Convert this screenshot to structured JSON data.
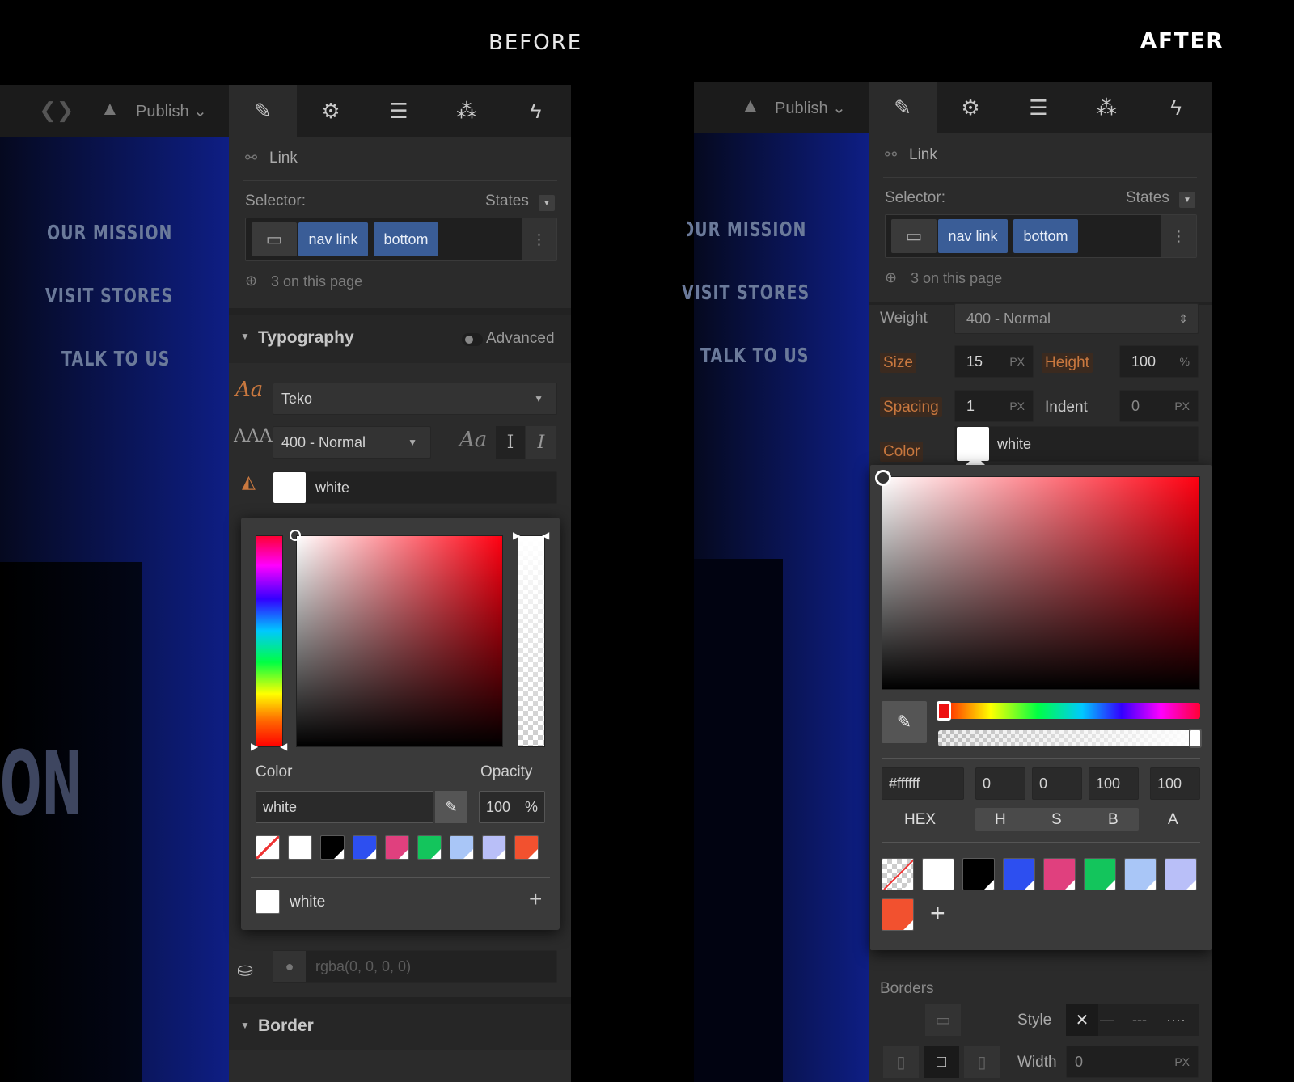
{
  "labels": {
    "before": "BEFORE",
    "after": "AFTER"
  },
  "toolbar": {
    "publish": "Publish"
  },
  "canvas_nav": [
    "OUR MISSION",
    "VISIT STORES",
    "TALK TO US"
  ],
  "panel": {
    "element_type": "Link",
    "selector_label": "Selector:",
    "states_label": "States",
    "tags": [
      "nav link",
      "bottom"
    ],
    "on_page": "3 on this page"
  },
  "before": {
    "typography_title": "Typography",
    "advanced_label": "Advanced",
    "font_family": "Teko",
    "font_weight": "400 - Normal",
    "color_value": "white",
    "picker": {
      "color_label": "Color",
      "opacity_label": "Opacity",
      "color_input": "white",
      "opacity_value": "100",
      "opacity_unit": "%",
      "saved_color_name": "white"
    },
    "background_placeholder": "rgba(0, 0, 0, 0)",
    "border_title": "Border"
  },
  "after": {
    "weight_label": "Weight",
    "weight_value": "400 - Normal",
    "size_label": "Size",
    "size_value": "15",
    "size_unit": "PX",
    "height_label": "Height",
    "height_value": "100",
    "height_unit": "%",
    "spacing_label": "Spacing",
    "spacing_value": "1",
    "spacing_unit": "PX",
    "indent_label": "Indent",
    "indent_value": "0",
    "indent_unit": "PX",
    "color_label": "Color",
    "color_value": "white",
    "picker": {
      "hex_value": "#ffffff",
      "h_value": "0",
      "s_value": "0",
      "b_value": "100",
      "a_value": "100",
      "hex_label": "HEX",
      "h_label": "H",
      "s_label": "S",
      "b_label": "B",
      "a_label": "A"
    },
    "borders_label": "Borders",
    "style_label": "Style",
    "width_label": "Width",
    "width_value": "0",
    "width_unit": "PX"
  },
  "swatches": [
    "#ffffff",
    "#000000",
    "#2d4ff0",
    "#e0407e",
    "#13c55c",
    "#a9c6f7",
    "#b9bff8",
    "#f2512f"
  ]
}
